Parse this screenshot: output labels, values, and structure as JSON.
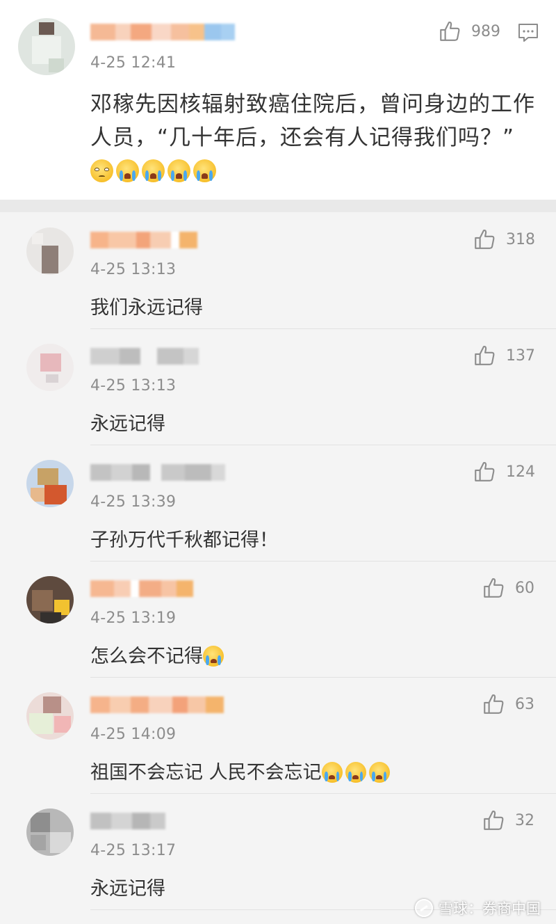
{
  "main_post": {
    "time": "4-25 12:41",
    "likes": "989",
    "text": "邓稼先因核辐射致癌住院后，曾问身边的工作人员，“几十年后，还会有人记得我们吗？”"
  },
  "replies": [
    {
      "time": "4-25 13:13",
      "likes": "318",
      "text": "我们永远记得"
    },
    {
      "time": "4-25 13:13",
      "likes": "137",
      "text": "永远记得"
    },
    {
      "time": "4-25 13:39",
      "likes": "124",
      "text": "子孙万代千秋都记得！"
    },
    {
      "time": "4-25 13:19",
      "likes": "60",
      "text": "怎么会不记得"
    },
    {
      "time": "4-25 14:09",
      "likes": "63",
      "text": "祖国不会忘记 人民不会忘记"
    },
    {
      "time": "4-25 13:17",
      "likes": "32",
      "text": "永远记得"
    }
  ],
  "icons": {
    "like": "thumbs-up-icon",
    "comment": "comment-icon",
    "emoji_sad": "sad-face-emoji-icon",
    "emoji_cry": "crying-face-emoji-icon"
  },
  "watermark": {
    "text": "雪球：券商中国"
  },
  "colors": {
    "text": "#333333",
    "meta": "#8c8c8c",
    "background": "#f4f4f4",
    "card": "#ffffff"
  }
}
